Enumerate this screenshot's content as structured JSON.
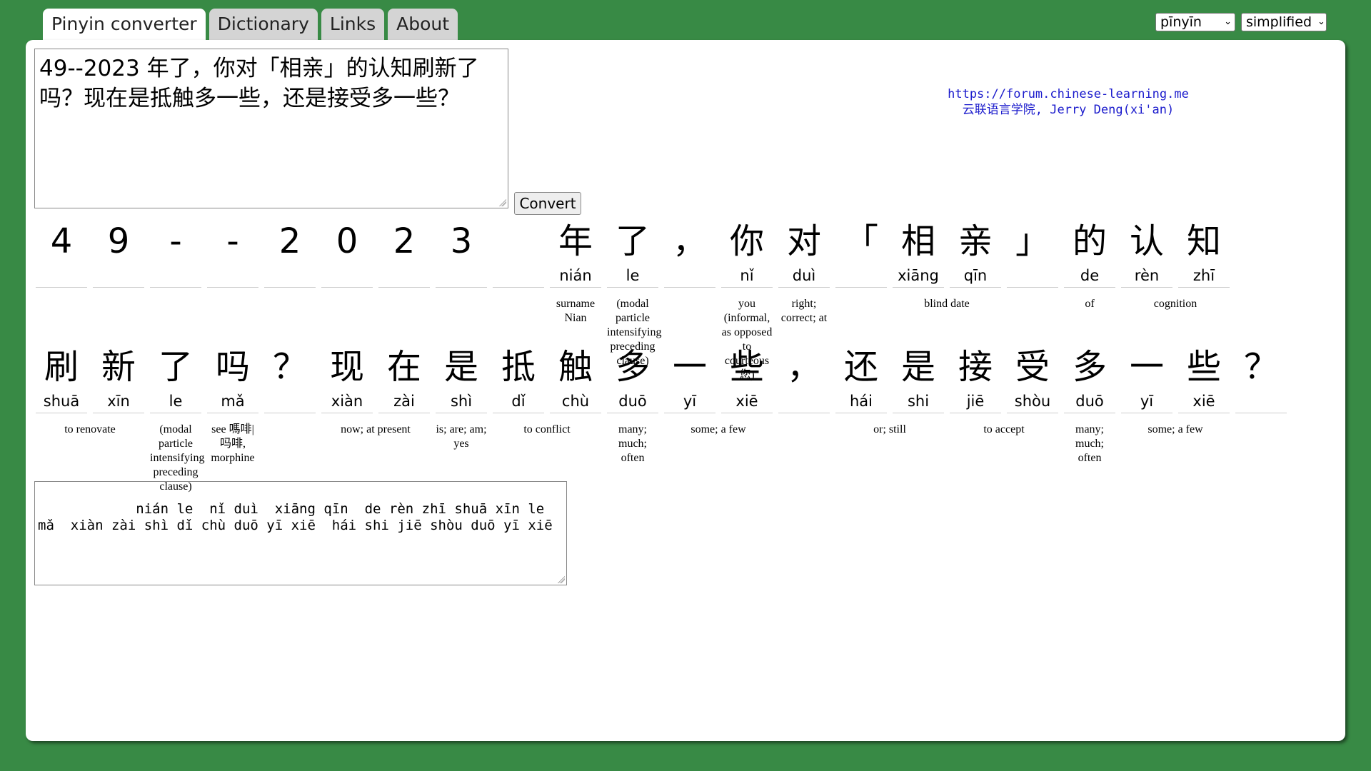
{
  "tabs": [
    "Pinyin converter",
    "Dictionary",
    "Links",
    "About"
  ],
  "selects": [
    "pīnyīn",
    "simplified"
  ],
  "input_text": "49--2023 年了，你对「相亲」的认知刷新了吗？现在是抵触多一些，还是接受多一些？",
  "convert_label": "Convert",
  "credit": [
    "https://forum.chinese-learning.me",
    "云联语言学院, Jerry Deng(xi'an)"
  ],
  "row1": [
    {
      "h": "4",
      "p": ""
    },
    {
      "h": "9",
      "p": ""
    },
    {
      "h": "-",
      "p": ""
    },
    {
      "h": "-",
      "p": ""
    },
    {
      "h": "2",
      "p": ""
    },
    {
      "h": "0",
      "p": ""
    },
    {
      "h": "2",
      "p": ""
    },
    {
      "h": "3",
      "p": ""
    },
    {
      "h": "",
      "p": ""
    },
    {
      "h": "年",
      "p": "nián"
    },
    {
      "h": "了",
      "p": "le"
    },
    {
      "h": "，",
      "p": ""
    },
    {
      "h": "你",
      "p": "nǐ"
    },
    {
      "h": "对",
      "p": "duì"
    },
    {
      "h": "「",
      "p": ""
    },
    {
      "h": "相",
      "p": "xiāng"
    },
    {
      "h": "亲",
      "p": "qīn"
    },
    {
      "h": "」",
      "p": ""
    },
    {
      "h": "的",
      "p": "de"
    },
    {
      "h": "认",
      "p": "rèn"
    },
    {
      "h": "知",
      "p": "zhī"
    }
  ],
  "row1_defs": [
    {
      "start": 9,
      "span": 1,
      "text": "surname Nian"
    },
    {
      "start": 10,
      "span": 1,
      "text": "(modal particle intensifying preceding clause)"
    },
    {
      "start": 12,
      "span": 1,
      "text": "you (informal, as opposed to courteous 您)"
    },
    {
      "start": 13,
      "span": 1,
      "text": "right; correct; at"
    },
    {
      "start": 15,
      "span": 2,
      "text": "blind date"
    },
    {
      "start": 18,
      "span": 1,
      "text": "of"
    },
    {
      "start": 19,
      "span": 2,
      "text": "cognition"
    }
  ],
  "row2": [
    {
      "h": "刷",
      "p": "shuā"
    },
    {
      "h": "新",
      "p": "xīn"
    },
    {
      "h": "了",
      "p": "le"
    },
    {
      "h": "吗",
      "p": "mǎ"
    },
    {
      "h": "？",
      "p": ""
    },
    {
      "h": "现",
      "p": "xiàn"
    },
    {
      "h": "在",
      "p": "zài"
    },
    {
      "h": "是",
      "p": "shì"
    },
    {
      "h": "抵",
      "p": "dǐ"
    },
    {
      "h": "触",
      "p": "chù"
    },
    {
      "h": "多",
      "p": "duō"
    },
    {
      "h": "一",
      "p": "yī"
    },
    {
      "h": "些",
      "p": "xiē"
    },
    {
      "h": "，",
      "p": ""
    },
    {
      "h": "还",
      "p": "hái"
    },
    {
      "h": "是",
      "p": "shi"
    },
    {
      "h": "接",
      "p": "jiē"
    },
    {
      "h": "受",
      "p": "shòu"
    },
    {
      "h": "多",
      "p": "duō"
    },
    {
      "h": "一",
      "p": "yī"
    },
    {
      "h": "些",
      "p": "xiē"
    },
    {
      "h": "？",
      "p": ""
    }
  ],
  "row2_defs": [
    {
      "start": 0,
      "span": 2,
      "text": "to renovate"
    },
    {
      "start": 2,
      "span": 1,
      "text": "(modal particle intensifying preceding clause)"
    },
    {
      "start": 3,
      "span": 1,
      "text": "see 嗎啡|吗啡, morphine"
    },
    {
      "start": 5,
      "span": 2,
      "text": "now; at present"
    },
    {
      "start": 7,
      "span": 1,
      "text": "is; are; am; yes"
    },
    {
      "start": 8,
      "span": 2,
      "text": "to conflict"
    },
    {
      "start": 10,
      "span": 1,
      "text": "many; much; often"
    },
    {
      "start": 11,
      "span": 2,
      "text": "some; a few"
    },
    {
      "start": 14,
      "span": 2,
      "text": "or; still"
    },
    {
      "start": 16,
      "span": 2,
      "text": "to accept"
    },
    {
      "start": 18,
      "span": 1,
      "text": "many; much; often"
    },
    {
      "start": 19,
      "span": 2,
      "text": "some; a few"
    }
  ],
  "output_text": "        nián le  nǐ duì  xiāng qīn  de rèn zhī shuā xīn le mǎ  xiàn zài shì dǐ chù duō yī xiē  hái shi jiē shòu duō yī xiē"
}
